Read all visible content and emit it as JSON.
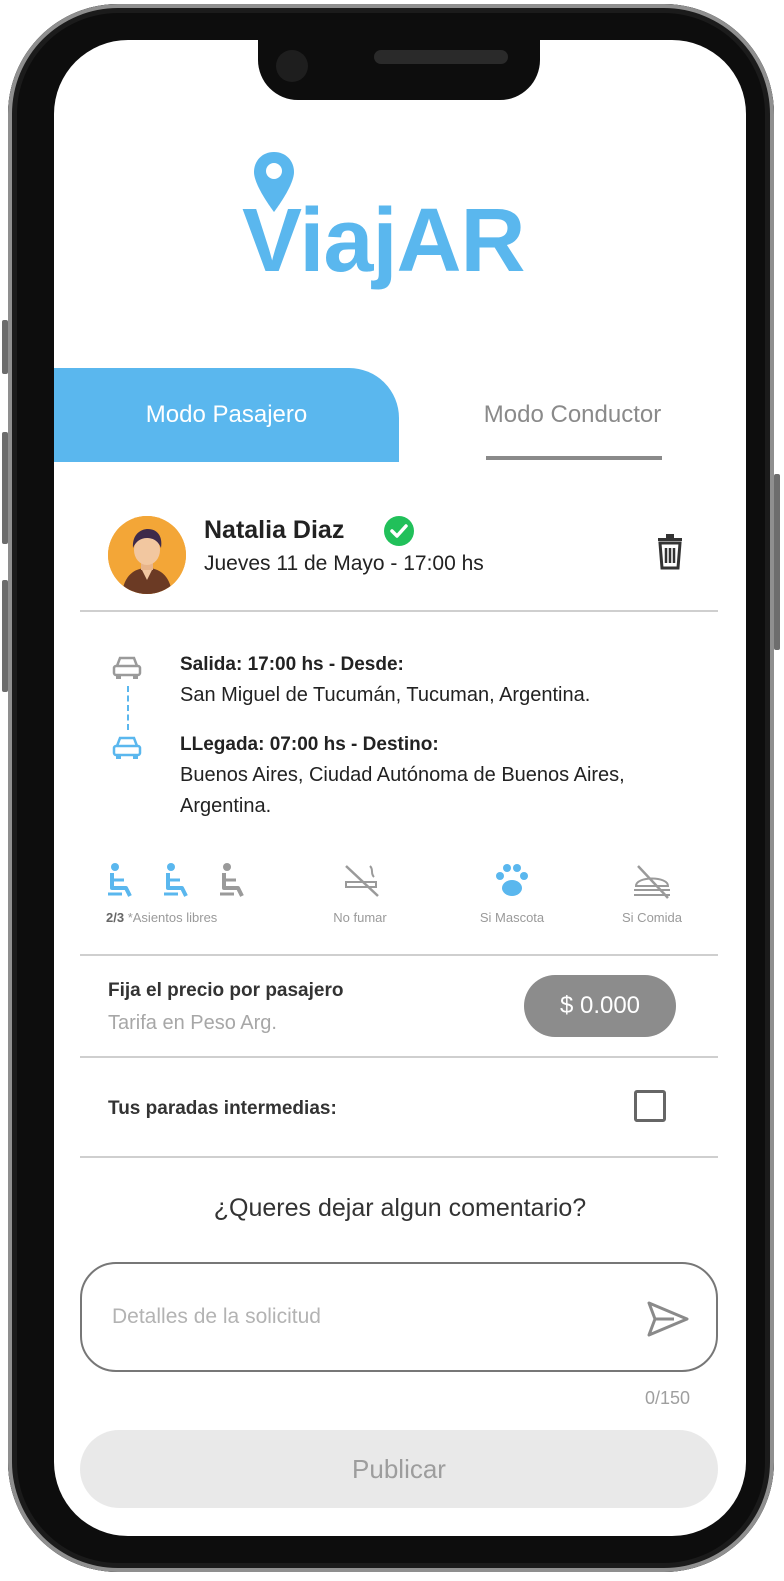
{
  "app": {
    "logo_text": "ViajAR",
    "brand_color": "#5ab7ee"
  },
  "tabs": [
    {
      "label": "Modo Pasajero",
      "active": true
    },
    {
      "label": "Modo Conductor",
      "active": false
    }
  ],
  "trip": {
    "user_name": "Natalia Diaz",
    "verified": true,
    "datetime": "Jueves 11 de Mayo - 17:00 hs",
    "departure_label": "Salida: 17:00 hs - Desde:",
    "departure_address": "San Miguel de Tucumán, Tucuman, Argentina.",
    "arrival_label": "LLegada: 07:00 hs - Destino:",
    "arrival_address": "Buenos Aires, Ciudad Autónoma de Buenos Aires, Argentina."
  },
  "features": {
    "seats_count": "2/3",
    "seats_label": "*Asientos libres",
    "seats_available": 2,
    "seats_total": 3,
    "no_smoking": "No fumar",
    "pets": "Si Mascota",
    "food": "Si Comida"
  },
  "price": {
    "label": "Fija el precio por pasajero",
    "sublabel": "Tarifa en Peso  Arg.",
    "value": "$ 0.000"
  },
  "stops": {
    "label": "Tus paradas intermedias:",
    "checked": false
  },
  "comment": {
    "title": "¿Queres dejar algun comentario?",
    "placeholder": "Detalles de la solicitud",
    "counter": "0/150"
  },
  "publish_label": "Publicar"
}
